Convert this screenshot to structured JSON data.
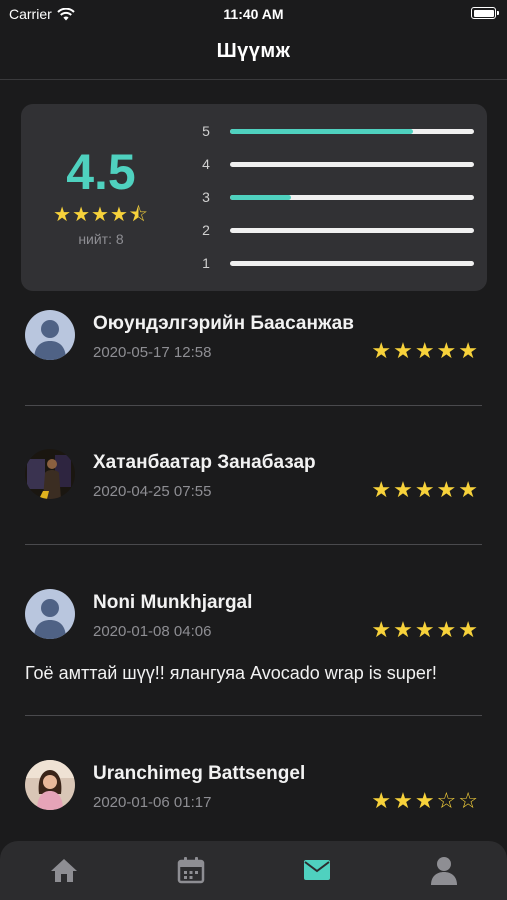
{
  "status_bar": {
    "carrier": "Carrier",
    "time": "11:40 AM"
  },
  "nav": {
    "title": "Шүүмж"
  },
  "summary": {
    "average": "4.5",
    "stars": "★★★★⯪",
    "total": "нийт: 8",
    "bars": [
      {
        "label": "5",
        "fraction": 0.75
      },
      {
        "label": "4",
        "fraction": 0
      },
      {
        "label": "3",
        "fraction": 0.25
      },
      {
        "label": "2",
        "fraction": 0
      },
      {
        "label": "1",
        "fraction": 0
      }
    ]
  },
  "reviews": [
    {
      "name": "Оюундэлгэрийн Баасанжав",
      "date": "2020-05-17 12:58",
      "stars": "★★★★★",
      "comment": ""
    },
    {
      "name": "Хатанбаатар Занабазар",
      "date": "2020-04-25 07:55",
      "stars": "★★★★★",
      "comment": ""
    },
    {
      "name": "Noni Munkhjargal",
      "date": "2020-01-08 04:06",
      "stars": "★★★★★",
      "comment": "Гоё амттай шүү!! ялангуяа Avocado wrap is super!"
    },
    {
      "name": "Uranchimeg Battsengel",
      "date": "2020-01-06 01:17",
      "stars": "★★★☆☆",
      "comment": ""
    }
  ],
  "tab_bar": {
    "tabs": [
      "home-icon",
      "calendar-icon",
      "mail-icon",
      "profile-icon"
    ],
    "active": "mail-icon"
  },
  "colors": {
    "accent": "#4fd1bf",
    "star": "#f7d23b",
    "background": "#1b1b1c",
    "card": "#313134"
  }
}
